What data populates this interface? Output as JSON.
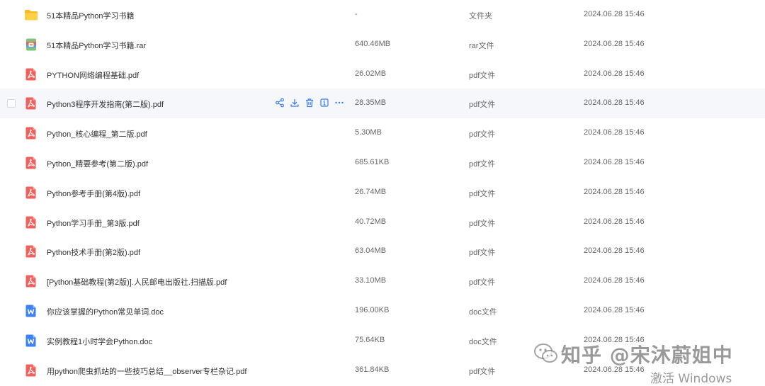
{
  "files": [
    {
      "name": "51本精品Python学习书籍",
      "size": "-",
      "type": "文件夹",
      "date": "2024.06.28 15:46",
      "icon": "folder-icon"
    },
    {
      "name": "51本精品Python学习书籍.rar",
      "size": "640.46MB",
      "type": "rar文件",
      "date": "2024.06.28 15:46",
      "icon": "rar-icon"
    },
    {
      "name": "PYTHON网络编程基础.pdf",
      "size": "26.02MB",
      "type": "pdf文件",
      "date": "2024.06.28 15:46",
      "icon": "pdf-icon"
    },
    {
      "name": "Python3程序开发指南(第二版).pdf",
      "size": "28.35MB",
      "type": "pdf文件",
      "date": "2024.06.28 15:46",
      "icon": "pdf-icon"
    },
    {
      "name": "Python_核心编程_第二版.pdf",
      "size": "5.30MB",
      "type": "pdf文件",
      "date": "2024.06.28 15:46",
      "icon": "pdf-icon"
    },
    {
      "name": "Python_精要参考(第二版).pdf",
      "size": "685.61KB",
      "type": "pdf文件",
      "date": "2024.06.28 15:46",
      "icon": "pdf-icon"
    },
    {
      "name": "Python参考手册(第4版).pdf",
      "size": "26.74MB",
      "type": "pdf文件",
      "date": "2024.06.28 15:46",
      "icon": "pdf-icon"
    },
    {
      "name": "Python学习手册_第3版.pdf",
      "size": "40.72MB",
      "type": "pdf文件",
      "date": "2024.06.28 15:46",
      "icon": "pdf-icon"
    },
    {
      "name": "Python技术手册(第2版).pdf",
      "size": "63.04MB",
      "type": "pdf文件",
      "date": "2024.06.28 15:46",
      "icon": "pdf-icon"
    },
    {
      "name": "[Python基础教程(第2版)].人民邮电出版社.扫描版.pdf",
      "size": "33.10MB",
      "type": "pdf文件",
      "date": "2024.06.28 15:46",
      "icon": "pdf-icon"
    },
    {
      "name": "你应该掌握的Python常见单词.doc",
      "size": "196.00KB",
      "type": "doc文件",
      "date": "2024.06.28 15:46",
      "icon": "doc-icon"
    },
    {
      "name": "实例教程1小时学会Python.doc",
      "size": "75.64KB",
      "type": "doc文件",
      "date": "2024.06.28 15:46",
      "icon": "doc-icon"
    },
    {
      "name": "用python爬虫抓站的一些技巧总结__observer专栏杂记.pdf",
      "size": "361.84KB",
      "type": "pdf文件",
      "date": "2024.06.28 15:46",
      "icon": "pdf-icon"
    }
  ],
  "hover_row_index": 3,
  "row_actions": [
    "share-icon",
    "download-icon",
    "delete-icon",
    "info-icon",
    "more-icon"
  ],
  "watermark": {
    "text": "知乎 @宋沐蔚姐中",
    "icon": "wechat-icon"
  },
  "activation_notice": "激活 Windows",
  "colors": {
    "folder": "#f9c744",
    "pdf": "#f0605c",
    "doc": "#3d82f2",
    "action": "#3b7bf2",
    "hover_bg": "#f5f7fb"
  }
}
